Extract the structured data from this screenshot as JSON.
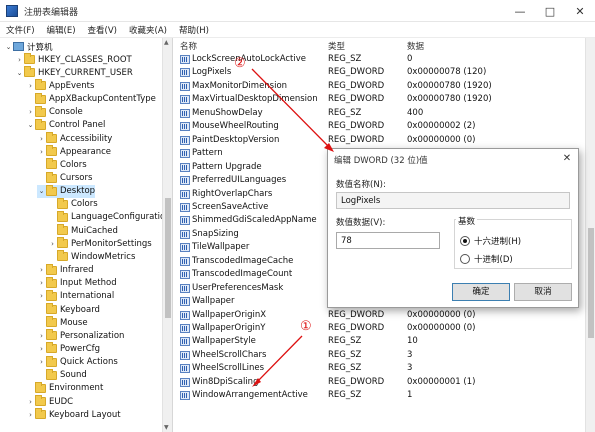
{
  "window": {
    "title": "注册表编辑器"
  },
  "window_buttons": {
    "minimize": "—",
    "maximize": "□",
    "close": "✕"
  },
  "menu": [
    "文件(F)",
    "编辑(E)",
    "查看(V)",
    "收藏夹(A)",
    "帮助(H)"
  ],
  "tree": [
    {
      "label": "计算机",
      "expander": "⌄",
      "icon": "computer-icon"
    },
    {
      "label": "HKEY_CLASSES_ROOT",
      "expander": "›",
      "icon": "folder-icon"
    },
    {
      "label": "HKEY_CURRENT_USER",
      "expander": "⌄",
      "icon": "folder-icon"
    },
    {
      "label": "AppEvents",
      "expander": "›",
      "icon": "folder-icon"
    },
    {
      "label": "AppXBackupContentType",
      "expander": "",
      "icon": "folder-icon"
    },
    {
      "label": "Console",
      "expander": "›",
      "icon": "folder-icon"
    },
    {
      "label": "Control Panel",
      "expander": "⌄",
      "icon": "folder-icon"
    },
    {
      "label": "Accessibility",
      "expander": "›",
      "icon": "folder-icon"
    },
    {
      "label": "Appearance",
      "expander": "›",
      "icon": "folder-icon"
    },
    {
      "label": "Colors",
      "expander": "",
      "icon": "folder-icon"
    },
    {
      "label": "Cursors",
      "expander": "",
      "icon": "folder-icon"
    },
    {
      "label": "Desktop",
      "expander": "⌄",
      "icon": "folder-icon"
    },
    {
      "label": "Colors",
      "expander": "",
      "icon": "folder-icon"
    },
    {
      "label": "LanguageConfiguratio",
      "expander": "",
      "icon": "folder-icon"
    },
    {
      "label": "MuiCached",
      "expander": "",
      "icon": "folder-icon"
    },
    {
      "label": "PerMonitorSettings",
      "expander": "›",
      "icon": "folder-icon"
    },
    {
      "label": "WindowMetrics",
      "expander": "",
      "icon": "folder-icon"
    },
    {
      "label": "Infrared",
      "expander": "›",
      "icon": "folder-icon"
    },
    {
      "label": "Input Method",
      "expander": "›",
      "icon": "folder-icon"
    },
    {
      "label": "International",
      "expander": "›",
      "icon": "folder-icon"
    },
    {
      "label": "Keyboard",
      "expander": "",
      "icon": "folder-icon"
    },
    {
      "label": "Mouse",
      "expander": "",
      "icon": "folder-icon"
    },
    {
      "label": "Personalization",
      "expander": "›",
      "icon": "folder-icon"
    },
    {
      "label": "PowerCfg",
      "expander": "›",
      "icon": "folder-icon"
    },
    {
      "label": "Quick Actions",
      "expander": "›",
      "icon": "folder-icon"
    },
    {
      "label": "Sound",
      "expander": "",
      "icon": "folder-icon"
    },
    {
      "label": "Environment",
      "expander": "",
      "icon": "folder-icon"
    },
    {
      "label": "EUDC",
      "expander": "›",
      "icon": "folder-icon"
    },
    {
      "label": "Keyboard Layout",
      "expander": "›",
      "icon": "folder-icon"
    }
  ],
  "list": {
    "headers": {
      "name": "名称",
      "type": "类型",
      "data": "数据"
    },
    "rows": [
      {
        "name": "LockScreenAutoLockActive",
        "type": "REG_SZ",
        "data": "0"
      },
      {
        "name": "LogPixels",
        "type": "REG_DWORD",
        "data": "0x00000078 (120)"
      },
      {
        "name": "MaxMonitorDimension",
        "type": "REG_DWORD",
        "data": "0x00000780 (1920)"
      },
      {
        "name": "MaxVirtualDesktopDimension",
        "type": "REG_DWORD",
        "data": "0x00000780 (1920)"
      },
      {
        "name": "MenuShowDelay",
        "type": "REG_SZ",
        "data": "400"
      },
      {
        "name": "MouseWheelRouting",
        "type": "REG_DWORD",
        "data": "0x00000002 (2)"
      },
      {
        "name": "PaintDesktopVersion",
        "type": "REG_DWORD",
        "data": "0x00000000 (0)"
      },
      {
        "name": "Pattern",
        "type": "",
        "data": ""
      },
      {
        "name": "Pattern Upgrade",
        "type": "",
        "data": ""
      },
      {
        "name": "PreferredUILanguages",
        "type": "",
        "data": ""
      },
      {
        "name": "RightOverlapChars",
        "type": "",
        "data": ""
      },
      {
        "name": "ScreenSaveActive",
        "type": "",
        "data": ""
      },
      {
        "name": "ShimmedGdiScaledAppName",
        "type": "",
        "data": ""
      },
      {
        "name": "SnapSizing",
        "type": "",
        "data": ""
      },
      {
        "name": "TileWallpaper",
        "type": "",
        "data": ""
      },
      {
        "name": "TranscodedImageCache",
        "type": "",
        "data": ""
      },
      {
        "name": "TranscodedImageCount",
        "type": "",
        "data": ""
      },
      {
        "name": "UserPreferencesMask",
        "type": "",
        "data": ""
      },
      {
        "name": "Wallpaper",
        "type": "",
        "data": ""
      },
      {
        "name": "WallpaperOriginX",
        "type": "REG_DWORD",
        "data": "0x00000000 (0)"
      },
      {
        "name": "WallpaperOriginY",
        "type": "REG_DWORD",
        "data": "0x00000000 (0)"
      },
      {
        "name": "WallpaperStyle",
        "type": "REG_SZ",
        "data": "10"
      },
      {
        "name": "WheelScrollChars",
        "type": "REG_SZ",
        "data": "3"
      },
      {
        "name": "WheelScrollLines",
        "type": "REG_SZ",
        "data": "3"
      },
      {
        "name": "Win8DpiScaling",
        "type": "REG_DWORD",
        "data": "0x00000001 (1)"
      },
      {
        "name": "WindowArrangementActive",
        "type": "REG_SZ",
        "data": "1"
      }
    ]
  },
  "dialog": {
    "title": "编辑 DWORD (32 位)值",
    "close": "✕",
    "name_label": "数值名称(N):",
    "name_value": "LogPixels",
    "data_label": "数值数据(V):",
    "data_value": "78",
    "base_label": "基数",
    "hex_label": "十六进制(H)",
    "dec_label": "十进制(D)",
    "ok": "确定",
    "cancel": "取消"
  },
  "annotations": {
    "one": "①",
    "two": "②"
  },
  "colors": {
    "annotation": "#dd1111",
    "folder": "#f2c94c",
    "selection": "#cce8ff"
  }
}
